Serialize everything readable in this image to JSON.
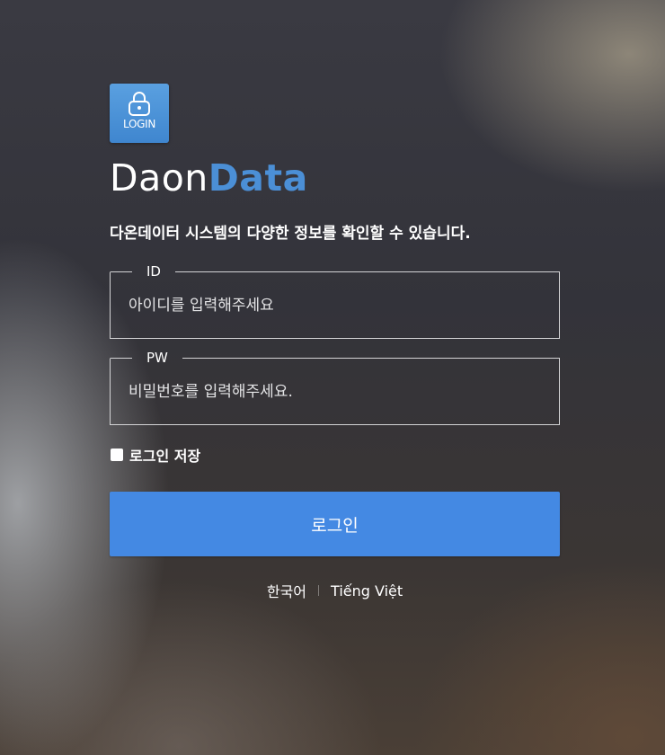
{
  "logo": {
    "icon_label": "LOGIN",
    "icon_name": "padlock-icon",
    "name_part1": "Daon",
    "name_part2": "Data",
    "accent_color": "#4b8fd6"
  },
  "description": "다온데이터 시스템의 다양한 정보를 확인할 수 있습니다.",
  "form": {
    "id": {
      "label": "ID",
      "value": "",
      "placeholder": "아이디를 입력해주세요"
    },
    "pw": {
      "label": "PW",
      "value": "",
      "placeholder": "비밀번호를 입력해주세요."
    },
    "remember_label": "로그인 저장",
    "remember_checked": false,
    "submit_label": "로그인",
    "button_color": "#4489e3"
  },
  "languages": {
    "korean": "한국어",
    "vietnamese": "Tiếng Việt"
  }
}
